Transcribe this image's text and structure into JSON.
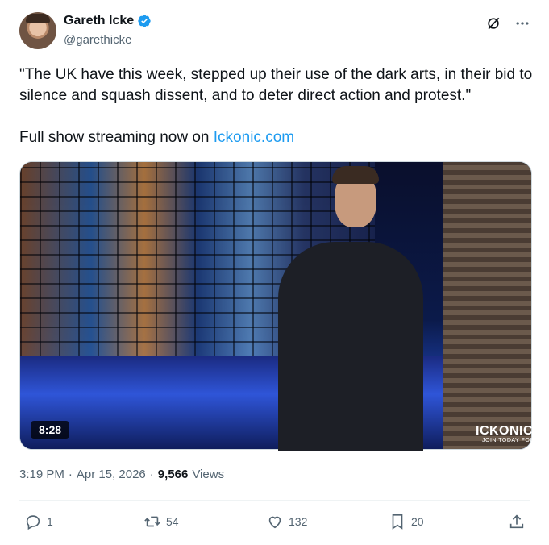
{
  "author": {
    "display_name": "Gareth Icke",
    "handle": "@garethicke",
    "avatar_icon": "avatar",
    "verified_color": "#1d9bf0"
  },
  "tweet": {
    "text_line": "\"The UK have this week, stepped up their use of the dark arts, in their bid to silence and squash dissent, and to deter direct action and protest.\"",
    "text_line2_prefix": "Full show streaming now on ",
    "link_text": "Ickonic.com"
  },
  "media": {
    "duration": "8:28",
    "brand": "ICKONIC",
    "brand_sub": "JOIN TODAY FOR"
  },
  "meta": {
    "time": "3:19 PM",
    "separator": "·",
    "date": "Apr 15, 2026",
    "views_count": "9,566",
    "views_label": "Views"
  },
  "actions": {
    "reply_count": "1",
    "retweet_count": "54",
    "like_count": "132",
    "bookmark_count": "20"
  },
  "colors": {
    "accent": "#1d9bf0",
    "text_secondary": "#536471",
    "text_primary": "#0f1419"
  }
}
